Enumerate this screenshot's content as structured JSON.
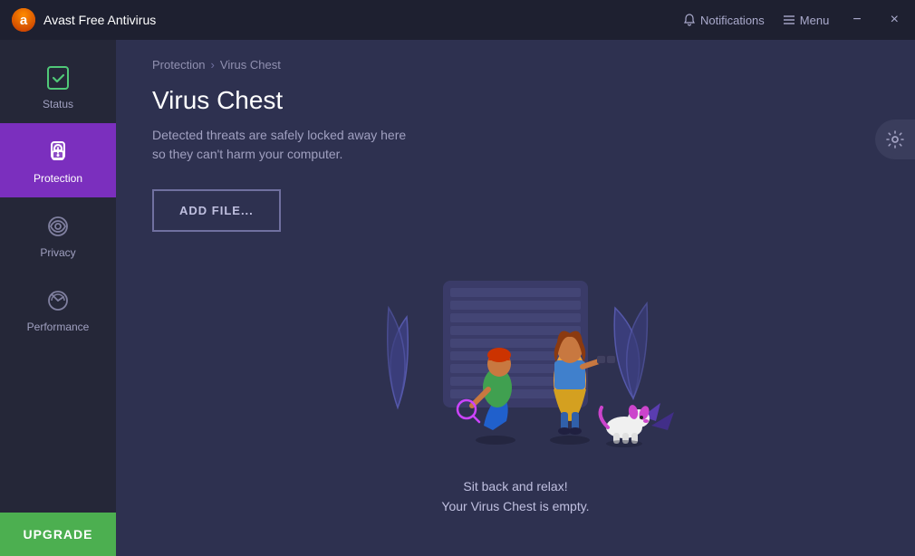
{
  "app": {
    "title": "Avast Free Antivirus"
  },
  "titlebar": {
    "notifications_label": "Notifications",
    "menu_label": "Menu",
    "minimize_label": "−",
    "close_label": "×"
  },
  "sidebar": {
    "items": [
      {
        "id": "status",
        "label": "Status",
        "active": false
      },
      {
        "id": "protection",
        "label": "Protection",
        "active": true
      },
      {
        "id": "privacy",
        "label": "Privacy",
        "active": false
      },
      {
        "id": "performance",
        "label": "Performance",
        "active": false
      }
    ],
    "upgrade_label": "UPGRADE"
  },
  "content": {
    "breadcrumb": {
      "parent": "Protection",
      "separator": "›",
      "current": "Virus Chest"
    },
    "title": "Virus Chest",
    "description": "Detected threats are safely locked away here\nso they can't harm your computer.",
    "add_file_button": "ADD FILE...",
    "empty_caption_line1": "Sit back and relax!",
    "empty_caption_line2": "Your Virus Chest is empty."
  },
  "colors": {
    "active_sidebar": "#7b2fbe",
    "upgrade_green": "#4caf50",
    "accent_purple": "#7c5cbf"
  }
}
